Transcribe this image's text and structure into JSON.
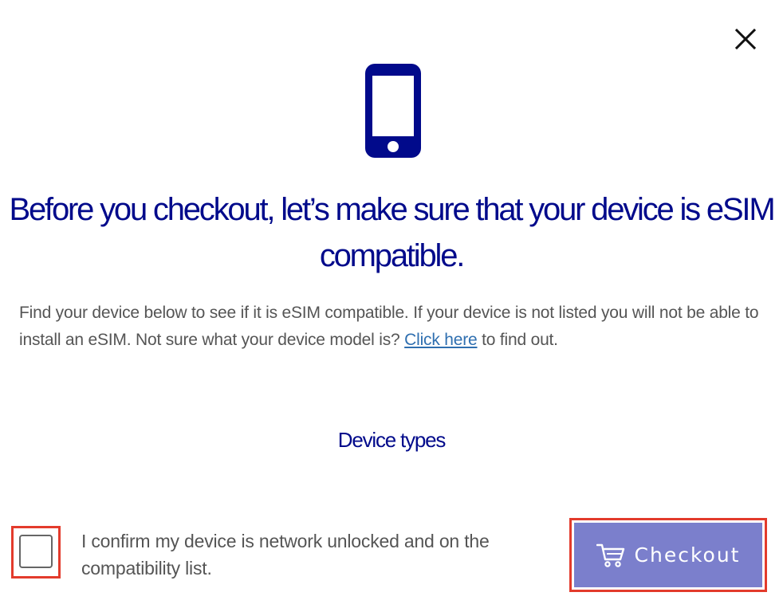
{
  "modal": {
    "title": "Before you checkout, let’s make sure that your device is eSIM compatible.",
    "description_before_link": "Find your device below to see if it is eSIM compatible. If your device is not listed you will not be able to install an eSIM. Not sure what your device model is? ",
    "link_text": "Click here",
    "description_after_link": " to find out.",
    "device_types_label": "Device types",
    "confirm_label": "I confirm my device is network unlocked and on the compatibility list.",
    "confirm_checked": false,
    "checkout_label": "Checkout"
  },
  "icons": {
    "close": "close-icon",
    "phone": "smartphone-icon",
    "cart": "cart-icon"
  },
  "colors": {
    "brand_navy": "#010a8b",
    "checkout_button": "#7b7fcc",
    "link": "#2f6fb0",
    "highlight_outline": "#e33b2c",
    "body_text": "#555555"
  }
}
